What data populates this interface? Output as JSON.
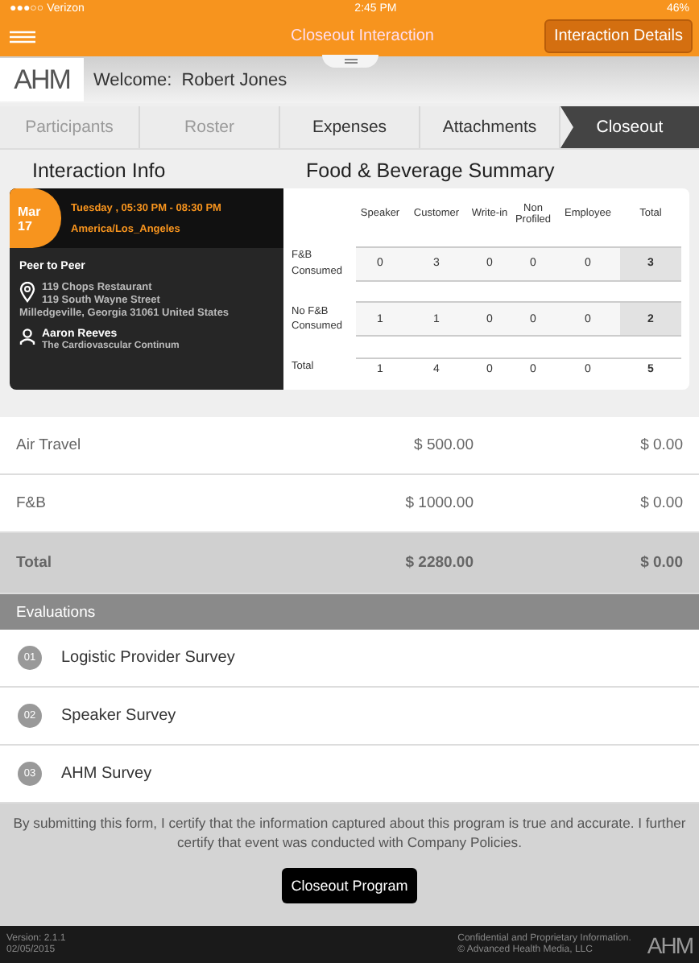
{
  "status_bar": {
    "carrier": "●●●○○ Verizon",
    "time": "2:45 PM",
    "battery": "46%"
  },
  "header": {
    "title": "Closeout Interaction",
    "button": "Interaction Details"
  },
  "welcome": {
    "logo": "AHM",
    "label": "Welcome:",
    "name": "Robert Jones"
  },
  "tabs": [
    {
      "label": "Participants",
      "selected": false,
      "disabled": true
    },
    {
      "label": "Roster",
      "selected": false,
      "disabled": true
    },
    {
      "label": "Expenses",
      "selected": false,
      "disabled": false
    },
    {
      "label": "Attachments",
      "selected": false,
      "disabled": false
    },
    {
      "label": "Closeout",
      "selected": true,
      "disabled": false
    }
  ],
  "interaction_info": {
    "title": "Interaction Info",
    "month": "Mar",
    "day": "17",
    "time": "Tuesday , 05:30 PM - 08:30 PM",
    "timezone": "America/Los_Angeles",
    "type": "Peer to Peer",
    "venue": "119 Chops Restaurant",
    "street": "119 South Wayne Street",
    "city": "Milledgeville, Georgia 31061 United States",
    "speaker": "Aaron Reeves",
    "topic": "The Cardiovascular Continum"
  },
  "fb_summary": {
    "title": "Food & Beverage Summary",
    "columns": [
      "Speaker",
      "Customer",
      "Write-in",
      "Non Profiled",
      "Employee",
      "Total"
    ],
    "rows": [
      {
        "label": "F&B Consumed",
        "values": [
          "0",
          "3",
          "0",
          "0",
          "0",
          "3"
        ]
      },
      {
        "label": "No F&B Consumed",
        "values": [
          "1",
          "1",
          "0",
          "0",
          "0",
          "2"
        ]
      }
    ],
    "total": {
      "label": "Total",
      "values": [
        "1",
        "4",
        "0",
        "0",
        "0",
        "5"
      ]
    }
  },
  "expenses": [
    {
      "name": "Air Travel",
      "amount": "$ 500.00",
      "other": "$ 0.00"
    },
    {
      "name": "F&B",
      "amount": "$ 1000.00",
      "other": "$ 0.00"
    }
  ],
  "expense_total": {
    "name": "Total",
    "amount": "$ 2280.00",
    "other": "$ 0.00"
  },
  "evaluations": {
    "title": "Evaluations",
    "items": [
      {
        "number": "01",
        "label": "Logistic Provider Survey"
      },
      {
        "number": "02",
        "label": "Speaker Survey"
      },
      {
        "number": "03",
        "label": "AHM Survey"
      }
    ]
  },
  "certification": "By submitting this form, I certify that the information captured about this program is true and accurate. I further certify that event was conducted with Company Policies.",
  "submit_button": "Closeout Program",
  "footer": {
    "version": "Version: 2.1.1",
    "date": "02/05/2015",
    "confidential": "Confidential and Proprietary Information.",
    "copyright": "© Advanced Health Media, LLC",
    "logo": "AHM"
  }
}
